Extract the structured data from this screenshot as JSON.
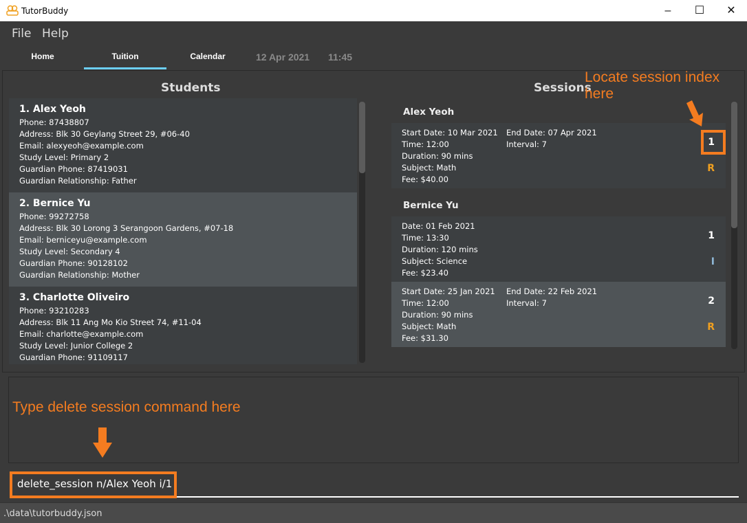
{
  "window": {
    "title": "TutorBuddy",
    "minimize": "–",
    "maximize": "☐",
    "close": "✕"
  },
  "menu": [
    "File",
    "Help"
  ],
  "tabs": [
    {
      "label": "Home"
    },
    {
      "label": "Tuition",
      "active": true
    },
    {
      "label": "Calendar"
    }
  ],
  "date": "12 Apr 2021",
  "time": "11:45",
  "students": {
    "title": "Students",
    "items": [
      {
        "name": "1.  Alex Yeoh",
        "lines": [
          "Phone: 87438807",
          "Address: Blk 30 Geylang Street 29, #06-40",
          "Email: alexyeoh@example.com",
          "Study Level: Primary 2",
          "Guardian Phone: 87419031",
          "Guardian Relationship: Father"
        ]
      },
      {
        "name": "2.  Bernice Yu",
        "lines": [
          "Phone: 99272758",
          "Address: Blk 30 Lorong 3 Serangoon Gardens, #07-18",
          "Email: berniceyu@example.com",
          "Study Level: Secondary 4",
          "Guardian Phone: 90128102",
          "Guardian Relationship: Mother"
        ]
      },
      {
        "name": "3.  Charlotte Oliveiro",
        "lines": [
          "Phone: 93210283",
          "Address: Blk 11 Ang Mo Kio Street 74, #11-04",
          "Email: charlotte@example.com",
          "Study Level: Junior College 2",
          "Guardian Phone: 91109117"
        ]
      }
    ]
  },
  "sessions": {
    "title": "Sessions",
    "groups": [
      {
        "name": "Alex Yeoh",
        "items": [
          {
            "col1": [
              "Start Date: 10 Mar 2021",
              "Time: 12:00",
              "Duration: 90 mins",
              "Subject: Math",
              "Fee: $40.00"
            ],
            "col2": [
              "End Date: 07 Apr 2021",
              "Interval: 7"
            ],
            "index": "1",
            "type": "R"
          }
        ]
      },
      {
        "name": "Bernice Yu",
        "items": [
          {
            "col1": [
              "Date: 01 Feb 2021",
              "Time: 13:30",
              "Duration: 120 mins",
              "Subject: Science",
              "Fee: $23.40"
            ],
            "col2": [],
            "index": "1",
            "type": "I"
          },
          {
            "col1": [
              "Start Date: 25 Jan 2021",
              "Time: 12:00",
              "Duration: 90 mins",
              "Subject: Math",
              "Fee: $31.30"
            ],
            "col2": [
              "End Date: 22 Feb 2021",
              "Interval: 7"
            ],
            "index": "2",
            "type": "R"
          }
        ]
      }
    ]
  },
  "command": {
    "value": "delete_session n/Alex Yeoh i/1"
  },
  "status": ".\\data\\tutorbuddy.json",
  "annotations": {
    "locate": "Locate session index here",
    "type": "Type delete session command here",
    "color": "#f47c20"
  },
  "colors": {
    "recurring": "#f0a020",
    "individual": "#8fb8d8",
    "tab_active": "#6ccff6"
  }
}
